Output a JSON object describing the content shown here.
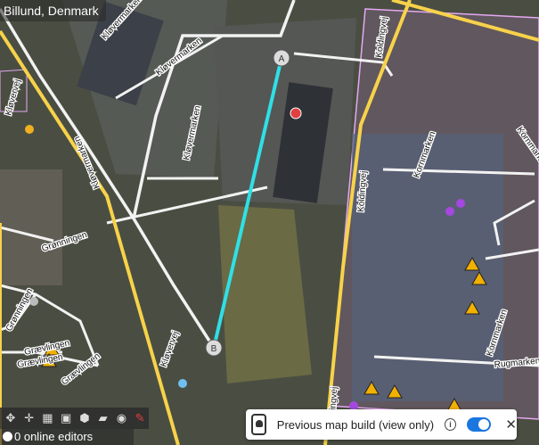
{
  "map": {
    "place_label": "Billund, Denmark",
    "route": {
      "start_marker": "A",
      "end_marker": "B",
      "color": "#2fe0e6"
    }
  },
  "streets": {
    "klovermarken_1": "Kløvermarken",
    "klovermarken_2": "Kløvermarken",
    "klovermarken_3": "Kløvermarken",
    "klovermarken_4": "Kløvermarken",
    "klovervej_1": "Kløvervej",
    "klovervej_2": "Kløvervej",
    "koldingvej_1": "Koldingvej",
    "koldingvej_2": "Koldingvej",
    "koldingvej_3": "Koldingvej",
    "kornmarken_1": "Kornmarken",
    "kornmarken_2": "Kornmarken",
    "kornmarken_3": "Kornmarken",
    "gronningen": "Grønningen",
    "gronningen_side": "Grønningen",
    "gravlingen_1": "Grævlingen",
    "gravlingen_2": "Grævlingen",
    "gravlingen_3": "Grævlingen",
    "rugmarken": "Rugmarken"
  },
  "toolbar": {
    "icons": [
      "move-icon",
      "crosshair-icon",
      "map-layers-icon",
      "photo-layer-icon",
      "area-layer-icon",
      "note-layer-icon",
      "help-icon",
      "issues-icon"
    ]
  },
  "status": {
    "online_editors": "0 online editors"
  },
  "banner": {
    "text": "Previous map build (view only)",
    "info_symbol": "i",
    "close_symbol": "✕",
    "toggle_on": true
  },
  "colors": {
    "major_road": "#f7d24a",
    "area_outline": "#e5a8f3",
    "poi_purple": "#a548e0",
    "poi_red": "#e04040",
    "poi_yellow": "#f0b020",
    "poi_blue": "#6fc0f0"
  }
}
